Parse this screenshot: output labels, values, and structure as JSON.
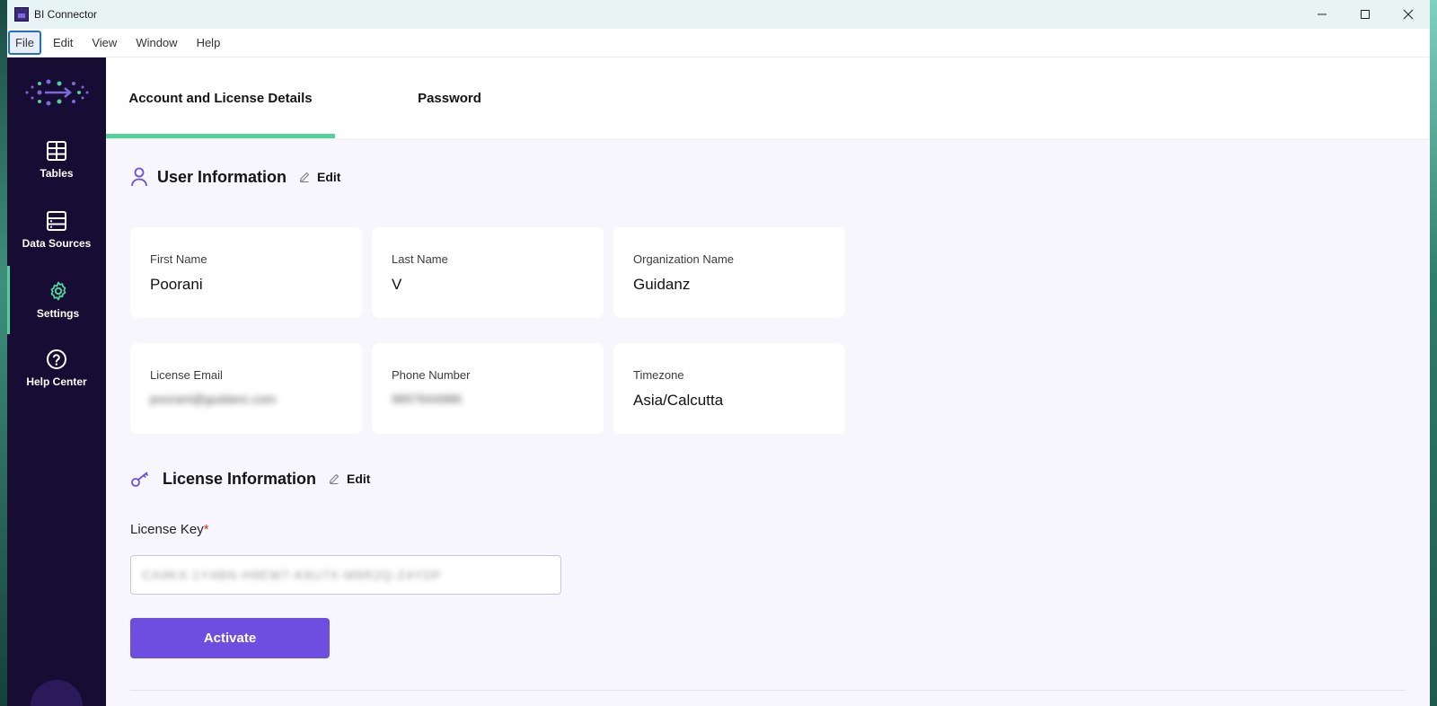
{
  "window": {
    "title": "BI Connector",
    "controls": [
      "minimize-icon",
      "maximize-icon",
      "close-icon"
    ]
  },
  "menu": {
    "items": [
      "File",
      "Edit",
      "View",
      "Window",
      "Help"
    ],
    "active": "File"
  },
  "sidebar": {
    "items": [
      {
        "label": "Tables",
        "icon": "table-grid-icon"
      },
      {
        "label": "Data Sources",
        "icon": "data-sources-icon"
      },
      {
        "label": "Settings",
        "icon": "gear-icon"
      },
      {
        "label": "Help Center",
        "icon": "question-icon"
      }
    ],
    "active": "Settings",
    "accent": "#4fd39a",
    "background": "#170c33"
  },
  "tabs": {
    "items": [
      "Account and License Details",
      "Password"
    ],
    "active": "Account and License Details"
  },
  "user_info": {
    "title": "User Information",
    "edit_label": "Edit",
    "fields": [
      {
        "label": "First Name",
        "value": "Poorani"
      },
      {
        "label": "Last Name",
        "value": "V"
      },
      {
        "label": "Organization Name",
        "value": "Guidanz"
      },
      {
        "label": "License Email",
        "value": "poorani@guidanz.com"
      },
      {
        "label": "Phone Number",
        "value": "9857644986"
      },
      {
        "label": "Timezone",
        "value": "Asia/Calcutta"
      }
    ]
  },
  "license_info": {
    "title": "License Information",
    "edit_label": "Edit",
    "key_label": "License Key",
    "required_mark": "*",
    "key_value": "CA9KX-1Y4BN-H9EW7-K6U7X-M8R2Q-Z4YDF",
    "activate_label": "Activate"
  },
  "colors": {
    "primary_button": "#6d4ee0",
    "tab_indicator": "#4fd39a",
    "icon_purple": "#6d4ee0"
  }
}
